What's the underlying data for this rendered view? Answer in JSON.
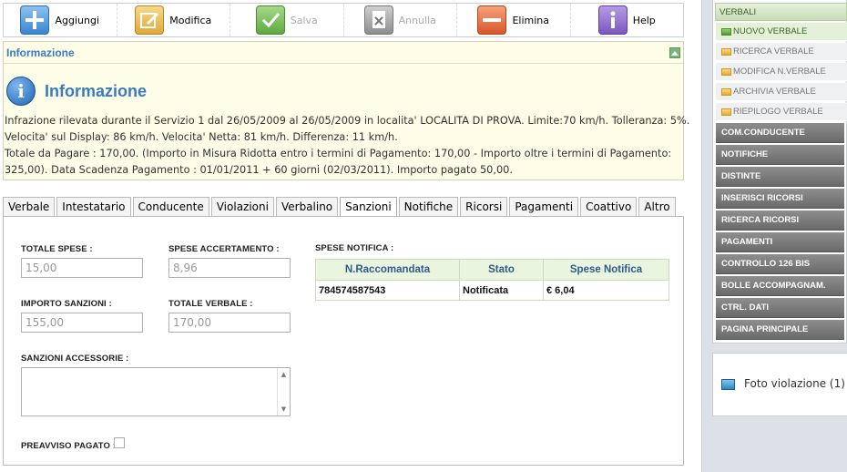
{
  "toolbar": {
    "buttons": [
      {
        "label": "Aggiungi",
        "icon": "plus-icon",
        "color": "#4a90d9"
      },
      {
        "label": "Modifica",
        "icon": "edit-icon",
        "color": "#e8b64a"
      },
      {
        "label": "Salva",
        "icon": "check-icon",
        "color": "#7cbf5a"
      },
      {
        "label": "Annulla",
        "icon": "cancel-document-icon",
        "color": "#9a9a9a"
      },
      {
        "label": "Elimina",
        "icon": "minus-icon",
        "color": "#e0683a"
      },
      {
        "label": "Help",
        "icon": "info-icon",
        "color": "#8e6cc7"
      }
    ]
  },
  "info": {
    "header_title": "Informazione",
    "title": "Informazione",
    "lines": [
      "Infrazione rilevata durante il Servizio 1 dal 26/05/2009 al 26/05/2009 in localita' LOCALITA DI PROVA. Limite:70 km/h. Tolleranza: 5%.",
      "Velocita' sul Display: 86 km/h. Velocita' Netta: 81 km/h. Differenza: 11 km/h.",
      "Totale da Pagare : 170,00. (Importo in Misura Ridotta entro i termini di Pagamento: 170,00 - Importo oltre i termini di Pagamento:",
      "325,00). Data Scadenza Pagamento : 01/01/2011 + 60 giorni (02/03/2011). Importo pagato 50,00."
    ]
  },
  "tabs": [
    "Verbale",
    "Intestatario",
    "Conducente",
    "Violazioni",
    "Verbalino",
    "Sanzioni",
    "Notifiche",
    "Ricorsi",
    "Pagamenti",
    "Coattivo",
    "Altro"
  ],
  "active_tab": "Sanzioni",
  "form": {
    "totale_spese_label": "TOTALE SPESE :",
    "totale_spese_value": "15,00",
    "spese_accertamento_label": "SPESE ACCERTAMENTO :",
    "spese_accertamento_value": "8,96",
    "importo_sanzioni_label": "IMPORTO SANZIONI :",
    "importo_sanzioni_value": "155,00",
    "totale_verbale_label": "TOTALE VERBALE :",
    "totale_verbale_value": "170,00",
    "sanzioni_accessorie_label": "SANZIONI ACCESSORIE :",
    "preavviso_label": "PREAVVISO PAGATO :",
    "spese_notifica_label": "SPESE NOTIFICA :"
  },
  "notifica_table": {
    "headers": [
      "N.Raccomandata",
      "Stato",
      "Spese Notifica"
    ],
    "rows": [
      [
        "784574587543",
        "Notificata",
        "€ 6,04"
      ]
    ]
  },
  "sidebar": {
    "section_title": "VERBALI",
    "sub_items": [
      "NUOVO VERBALE",
      "RICERCA VERBALE",
      "MODIFICA N.VERBALE",
      "ARCHIVIA VERBALE",
      "RIEPILOGO VERBALE"
    ],
    "main_items": [
      "COM.CONDUCENTE",
      "NOTIFICHE",
      "DISTINTE",
      "INSERISCI RICORSI",
      "RICERCA RICORSI",
      "PAGAMENTI",
      "CONTROLLO 126 BIS",
      "BOLLE ACCOMPAGNAM.",
      "CTRL. DATI",
      "PAGINA PRINCIPALE"
    ],
    "foto_label": "Foto violazione (1)"
  }
}
